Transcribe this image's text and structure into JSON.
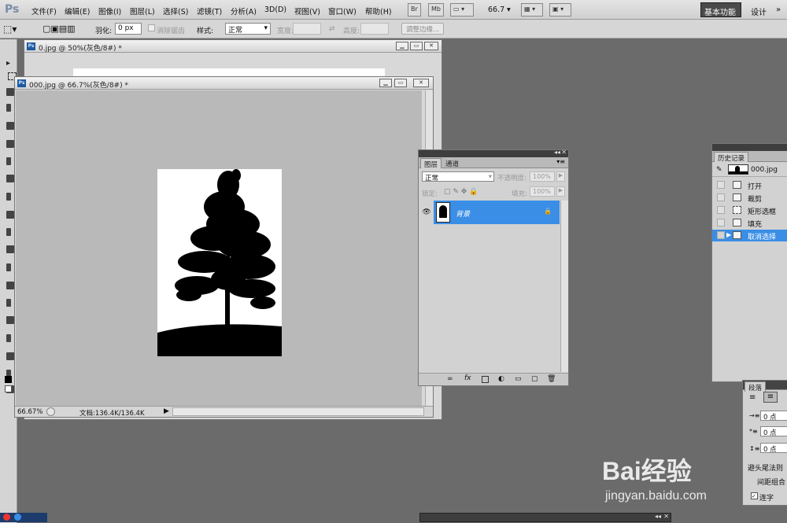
{
  "menubar": {
    "logo": "Ps",
    "items": [
      "文件(F)",
      "编辑(E)",
      "图像(I)",
      "图层(L)",
      "选择(S)",
      "滤镜(T)",
      "分析(A)",
      "3D(D)",
      "视图(V)",
      "窗口(W)",
      "帮助(H)"
    ],
    "br": "Br",
    "mb": "Mb",
    "zoom": "66.7",
    "workspace_active": "基本功能",
    "workspace_design": "设计"
  },
  "options": {
    "feather_label": "羽化:",
    "feather_value": "0 px",
    "antialias_label": "消除锯齿",
    "style_label": "样式:",
    "style_value": "正常",
    "width_label": "宽度:",
    "height_label": "高度:",
    "refine_edge": "调整边缘..."
  },
  "doc_back": {
    "title": "0.jpg @ 50%(灰色/8#) *"
  },
  "doc_front": {
    "title": "000.jpg @ 66.7%(灰色/8#) *",
    "zoom_status": "66.67%",
    "doc_status": "文档:136.4K/136.4K"
  },
  "layers_panel": {
    "tab_layers": "图层",
    "tab_channels": "通道",
    "blend_mode": "正常",
    "opacity_label": "不透明度:",
    "opacity_value": "100%",
    "lock_label": "锁定:",
    "fill_label": "填充:",
    "fill_value": "100%",
    "layer_name": "背景",
    "footer_fx": "fx"
  },
  "history_panel": {
    "tab": "历史记录",
    "snapshot": "000.jpg",
    "items": [
      "打开",
      "裁剪",
      "矩形选框",
      "填充",
      "取消选择"
    ]
  },
  "paragraph_panel": {
    "tab": "段落",
    "indent1": "0 点",
    "indent2": "0 点",
    "indent3": "0 点",
    "rule": "避头尾法则",
    "spacing": "间距组合",
    "hyphen": "连字"
  },
  "watermark": {
    "brand": "Bai经验",
    "url": "jingyan.baidu.com"
  },
  "colors": {
    "selection": "#3a8ee6",
    "workspace_bg": "#6b6b6b",
    "canvas_bg": "#b9b9b9"
  }
}
